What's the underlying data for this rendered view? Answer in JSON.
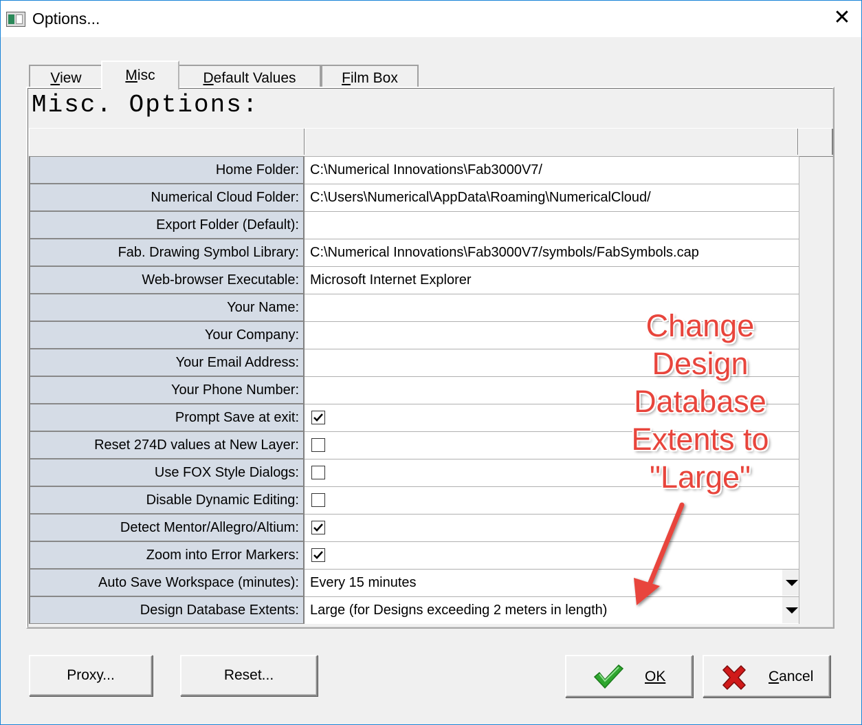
{
  "window": {
    "title": "Options...",
    "close_glyph": "✕"
  },
  "tabs": [
    {
      "label": "View",
      "mnemonic": "V",
      "rest": "iew",
      "active": false
    },
    {
      "label": "Misc",
      "mnemonic": "M",
      "rest": "isc",
      "active": true
    },
    {
      "label": "Default Values",
      "mnemonic": "D",
      "rest": "efault Values",
      "active": false
    },
    {
      "label": "Film Box",
      "mnemonic": "F",
      "rest": "ilm Box",
      "active": false
    }
  ],
  "heading": "Misc. Options:",
  "options": [
    {
      "label": "Home Folder:",
      "type": "text",
      "value": "C:\\Numerical Innovations\\Fab3000V7/"
    },
    {
      "label": "Numerical Cloud Folder:",
      "type": "text",
      "value": "C:\\Users\\Numerical\\AppData\\Roaming\\NumericalCloud/"
    },
    {
      "label": "Export Folder (Default):",
      "type": "text",
      "value": ""
    },
    {
      "label": "Fab. Drawing Symbol Library:",
      "type": "text",
      "value": "C:\\Numerical Innovations\\Fab3000V7/symbols/FabSymbols.cap"
    },
    {
      "label": "Web-browser Executable:",
      "type": "text",
      "value": "Microsoft Internet Explorer"
    },
    {
      "label": "Your Name:",
      "type": "text",
      "value": ""
    },
    {
      "label": "Your Company:",
      "type": "text",
      "value": ""
    },
    {
      "label": "Your Email Address:",
      "type": "text",
      "value": ""
    },
    {
      "label": "Your Phone Number:",
      "type": "text",
      "value": ""
    },
    {
      "label": "Prompt Save at exit:",
      "type": "checkbox",
      "checked": true
    },
    {
      "label": "Reset 274D values at New Layer:",
      "type": "checkbox",
      "checked": false
    },
    {
      "label": "Use FOX Style Dialogs:",
      "type": "checkbox",
      "checked": false
    },
    {
      "label": "Disable Dynamic Editing:",
      "type": "checkbox",
      "checked": false
    },
    {
      "label": "Detect Mentor/Allegro/Altium:",
      "type": "checkbox",
      "checked": true
    },
    {
      "label": "Zoom into Error Markers:",
      "type": "checkbox",
      "checked": true
    },
    {
      "label": "Auto Save Workspace (minutes):",
      "type": "dropdown",
      "value": "Every 15 minutes"
    },
    {
      "label": "Design Database Extents:",
      "type": "dropdown",
      "value": "Large (for Designs exceeding 2 meters in length)"
    }
  ],
  "buttons": {
    "proxy": "Proxy...",
    "reset": "Reset...",
    "ok": "OK",
    "cancel": "Cancel"
  },
  "annotation": {
    "lines": [
      "Change",
      "Design",
      "Database",
      "Extents to",
      "\"Large\""
    ],
    "color": "#e8453c"
  },
  "colors": {
    "label_bg": "#d5dce6",
    "ok_check": "#2ea62e",
    "cancel_x": "#d01a1a"
  },
  "icons": {
    "ok": "green-checkmark-icon",
    "cancel": "red-x-icon",
    "dropdown": "triangle-down-icon"
  }
}
